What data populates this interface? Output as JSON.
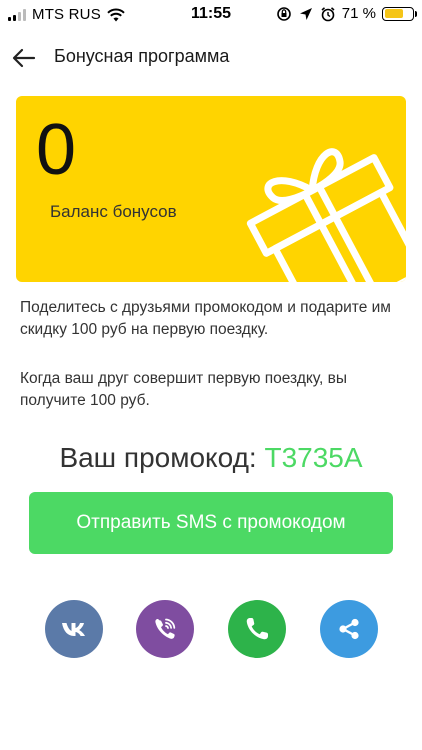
{
  "status_bar": {
    "carrier": "MTS RUS",
    "time": "11:55",
    "battery_percent": "71 %",
    "battery_level": 0.71
  },
  "header": {
    "title": "Бонусная программа",
    "back_icon": "arrow-left-icon"
  },
  "bonus_card": {
    "balance": "0",
    "label": "Баланс бонусов",
    "color": "#ffd400",
    "icon": "gift-icon"
  },
  "info": {
    "line1": "Поделитесь с друзьями промокодом и подарите им скидку  100 руб на первую поездку.",
    "line2": "Когда ваш друг совершит первую поездку, вы получите 100 руб."
  },
  "promo": {
    "label": "Ваш промокод: ",
    "code": "T3735A",
    "code_color": "#4cd964"
  },
  "sms_button": {
    "label": "Отправить SMS с промокодом",
    "color": "#4cd964"
  },
  "share": [
    {
      "name": "vk",
      "icon": "vk-icon",
      "color": "#5b7aa8"
    },
    {
      "name": "viber",
      "icon": "viber-icon",
      "color": "#7f4da0"
    },
    {
      "name": "whatsapp",
      "icon": "phone-icon",
      "color": "#2db34a"
    },
    {
      "name": "share",
      "icon": "share-icon",
      "color": "#3d9be0"
    }
  ]
}
